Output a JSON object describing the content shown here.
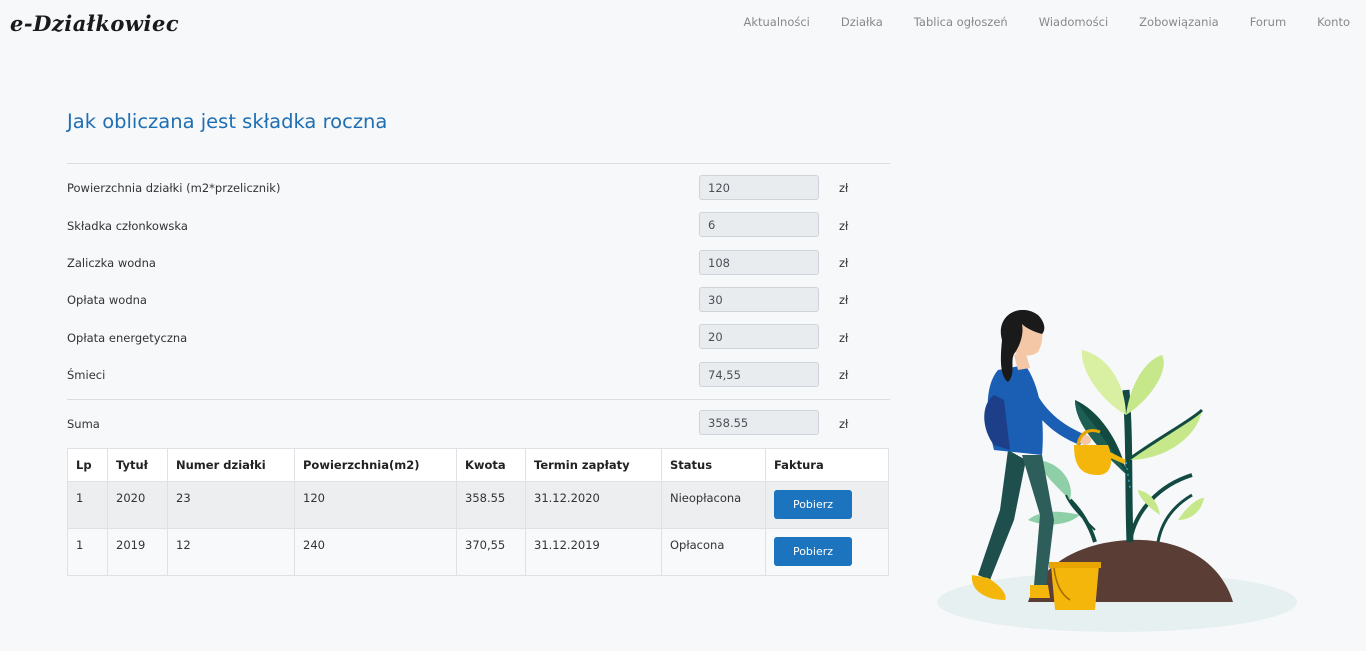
{
  "app": {
    "logo": "e-Działkowiec"
  },
  "nav": [
    "Aktualności",
    "Działka",
    "Tablica ogłoszeń",
    "Wiadomości",
    "Zobowiązania",
    "Forum",
    "Konto"
  ],
  "page": {
    "title": "Jak obliczana jest składka roczna"
  },
  "fields": [
    {
      "label": "Powierzchnia działki (m2*przelicznik)",
      "value": "120",
      "unit": "zł"
    },
    {
      "label": "Składka członkowska",
      "value": "6",
      "unit": "zł"
    },
    {
      "label": "Zaliczka wodna",
      "value": "108",
      "unit": "zł"
    },
    {
      "label": "Opłata wodna",
      "value": "30",
      "unit": "zł"
    },
    {
      "label": "Opłata energetyczna",
      "value": "20",
      "unit": "zł"
    },
    {
      "label": "Śmieci",
      "value": "74,55",
      "unit": "zł"
    }
  ],
  "sum": {
    "label": "Suma",
    "value": "358.55",
    "unit": "zł"
  },
  "table": {
    "headers": [
      "Lp",
      "Tytuł",
      "Numer działki",
      "Powierzchnia(m2)",
      "Kwota",
      "Termin zapłaty",
      "Status",
      "Faktura"
    ],
    "rows": [
      {
        "lp": "1",
        "tytul": "2020",
        "numer": "23",
        "powierzchnia": "120",
        "kwota": "358.55",
        "termin": "31.12.2020",
        "status": "Nieopłacona",
        "button": "Pobierz"
      },
      {
        "lp": "1",
        "tytul": "2019",
        "numer": "12",
        "powierzchnia": "240",
        "kwota": "370,55",
        "termin": "31.12.2019",
        "status": "Opłacona",
        "button": "Pobierz"
      }
    ]
  },
  "colors": {
    "accent": "#1f6fb2",
    "button": "#1b74bd"
  }
}
